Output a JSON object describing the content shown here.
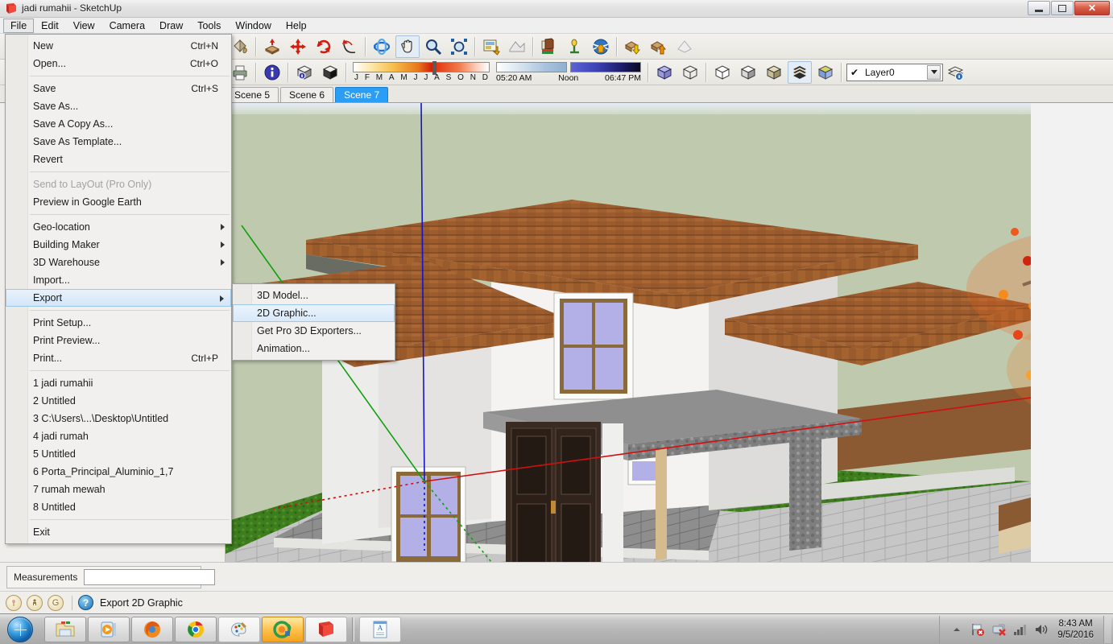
{
  "window": {
    "title": "jadi rumahii - SketchUp",
    "app_icon": "sketchup-icon",
    "controls": {
      "minimize": "minimize-icon",
      "restore": "restore-icon",
      "close": "close-icon"
    }
  },
  "menubar": {
    "items": [
      {
        "label": "File",
        "active": true
      },
      {
        "label": "Edit",
        "active": false
      },
      {
        "label": "View",
        "active": false
      },
      {
        "label": "Camera",
        "active": false
      },
      {
        "label": "Draw",
        "active": false
      },
      {
        "label": "Tools",
        "active": false
      },
      {
        "label": "Window",
        "active": false
      },
      {
        "label": "Help",
        "active": false
      }
    ]
  },
  "file_menu": {
    "groups": [
      [
        {
          "label": "New",
          "accel": "Ctrl+N"
        },
        {
          "label": "Open...",
          "accel": "Ctrl+O"
        }
      ],
      [
        {
          "label": "Save",
          "accel": "Ctrl+S"
        },
        {
          "label": "Save As...",
          "accel": ""
        },
        {
          "label": "Save A Copy As...",
          "accel": ""
        },
        {
          "label": "Save As Template...",
          "accel": ""
        },
        {
          "label": "Revert",
          "accel": ""
        }
      ],
      [
        {
          "label": "Send to LayOut (Pro Only)",
          "accel": "",
          "disabled": true
        },
        {
          "label": "Preview in Google Earth",
          "accel": ""
        }
      ],
      [
        {
          "label": "Geo-location",
          "accel": "",
          "submenu": true
        },
        {
          "label": "Building Maker",
          "accel": "",
          "submenu": true
        },
        {
          "label": "3D Warehouse",
          "accel": "",
          "submenu": true
        },
        {
          "label": "Import...",
          "accel": ""
        },
        {
          "label": "Export",
          "accel": "",
          "submenu": true,
          "selected": true
        }
      ],
      [
        {
          "label": "Print Setup...",
          "accel": ""
        },
        {
          "label": "Print Preview...",
          "accel": ""
        },
        {
          "label": "Print...",
          "accel": "Ctrl+P"
        }
      ],
      [
        {
          "label": "1 jadi rumahii",
          "accel": ""
        },
        {
          "label": "2 Untitled",
          "accel": ""
        },
        {
          "label": "3 C:\\Users\\...\\Desktop\\Untitled",
          "accel": ""
        },
        {
          "label": "4 jadi rumah",
          "accel": ""
        },
        {
          "label": "5 Untitled",
          "accel": ""
        },
        {
          "label": "6 Porta_Principal_Aluminio_1,7",
          "accel": ""
        },
        {
          "label": "7 rumah mewah",
          "accel": ""
        },
        {
          "label": "8 Untitled",
          "accel": ""
        }
      ],
      [
        {
          "label": "Exit",
          "accel": ""
        }
      ]
    ]
  },
  "export_submenu": {
    "items": [
      {
        "label": "3D Model...",
        "selected": false
      },
      {
        "label": "2D Graphic...",
        "selected": true
      },
      {
        "label": "Get Pro 3D Exporters...",
        "selected": false
      },
      {
        "label": "Animation...",
        "selected": false
      }
    ]
  },
  "toolbars": {
    "row1_icons": [
      "paint-bucket-icon",
      "push-pull-icon",
      "move-icon",
      "rotate-icon",
      "follow-me-icon",
      "orbit-icon",
      "pan-icon",
      "zoom-icon",
      "zoom-extents-icon",
      "add-location-icon",
      "toggle-terrain-icon",
      "photo-textures-icon",
      "place-model-icon",
      "get-models-icon",
      "download-component-icon",
      "upload-component-icon",
      "share-model-icon"
    ],
    "row2_icons": [
      "print-icon",
      "model-info-icon",
      "component-info-icon",
      "solid-tools-icon",
      "iso-view-icon",
      "wireframe-icon",
      "hidden-line-icon",
      "shaded-icon",
      "shaded-texture-icon",
      "monochrome-icon",
      "xray-icon"
    ],
    "shadows": {
      "month_labels": [
        "J",
        "F",
        "M",
        "A",
        "M",
        "J",
        "J",
        "A",
        "S",
        "O",
        "N",
        "D"
      ],
      "month_thumb_percent": 58,
      "time_start": "05:20 AM",
      "time_noon": "Noon",
      "time_end": "06:47 PM"
    },
    "layer": {
      "checked_glyph": "check-icon",
      "value": "Layer0",
      "dropdown_icon": "chevron-down-icon",
      "layer_manager_icon": "layer-manager-icon"
    }
  },
  "scene_tabs": {
    "tabs": [
      {
        "label": "Scene 5",
        "active": false
      },
      {
        "label": "Scene 6",
        "active": false
      },
      {
        "label": "Scene 7",
        "active": true
      }
    ]
  },
  "viewport": {
    "model_description": "Two-story white stucco house with terracotta tile roofs, purple-tinted windows, grey stone porch canopy and an autumn tree",
    "colors": {
      "sky": "#dfe6ef",
      "background": "#bfc9ae",
      "grass": "#3f7f1f",
      "roof_tile": "#9a5a2c",
      "wall": "#f2f1ee",
      "window_glass": "#b0aee4",
      "porch_stone": "#8d8d8d",
      "paving": "#c9c9c9",
      "dirt": "#8a5a33",
      "tree_foliage": "#e8541f",
      "axis_red": "#d01010",
      "axis_green": "#10a010",
      "axis_blue": "#1414c8"
    }
  },
  "measurements": {
    "label": "Measurements",
    "value": "",
    "placeholder": ""
  },
  "status": {
    "icons": [
      "position-icon",
      "person-icon",
      "google-icon"
    ],
    "help_icon": "help-icon",
    "text": "Export 2D Graphic"
  },
  "taskbar": {
    "start_icon": "windows-start-orb",
    "buttons": [
      {
        "icon": "file-explorer-icon",
        "highlight": false
      },
      {
        "icon": "media-player-icon",
        "highlight": false
      },
      {
        "icon": "firefox-icon",
        "highlight": false
      },
      {
        "icon": "chrome-icon",
        "highlight": false
      },
      {
        "icon": "paint-icon",
        "highlight": false
      },
      {
        "icon": "antivirus-icon",
        "highlight": true
      },
      {
        "icon": "sketchup-icon",
        "highlight": false
      },
      {
        "icon": "wordpad-icon",
        "highlight": false
      }
    ],
    "tray": {
      "expand_icon": "chevron-up-icon",
      "icons": [
        "flag-alert-icon",
        "network-error-icon",
        "signal-icon",
        "volume-icon"
      ],
      "time": "8:43 AM",
      "date": "9/5/2016"
    }
  }
}
